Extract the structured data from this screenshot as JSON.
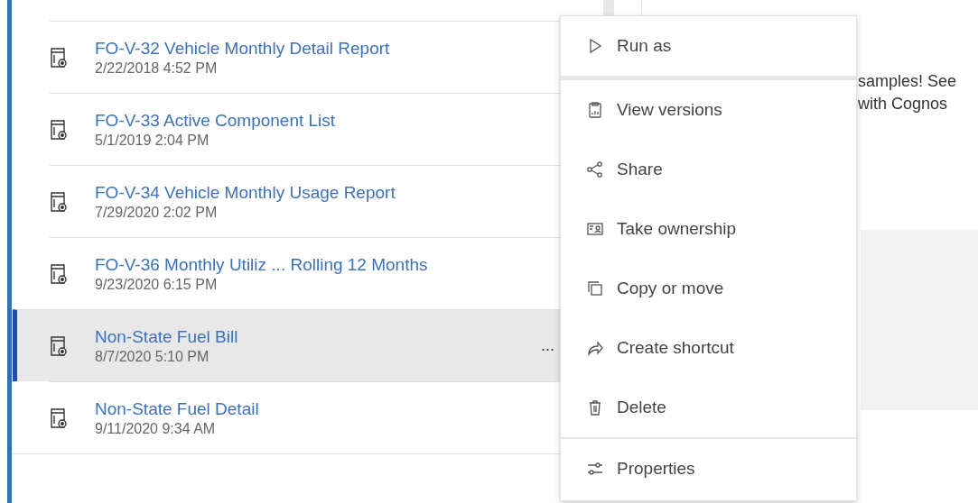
{
  "reports": [
    {
      "title": "FO-V-32 Vehicle Monthly Detail Report",
      "date": "2/22/2018 4:52 PM",
      "selected": false
    },
    {
      "title": "FO-V-33 Active Component List",
      "date": "5/1/2019 2:04 PM",
      "selected": false
    },
    {
      "title": "FO-V-34 Vehicle Monthly Usage Report",
      "date": "7/29/2020 2:02 PM",
      "selected": false
    },
    {
      "title": "FO-V-36 Monthly Utiliz ... Rolling 12 Months",
      "date": "9/23/2020 6:15 PM",
      "selected": false
    },
    {
      "title": "Non-State Fuel Bill",
      "date": "8/7/2020 5:10 PM",
      "selected": true,
      "more": "..."
    },
    {
      "title": "Non-State Fuel Detail",
      "date": "9/11/2020 9:34 AM",
      "selected": false
    }
  ],
  "side_text": [
    "samples! See",
    "with Cognos"
  ],
  "context_menu": [
    [
      "Run as"
    ],
    [
      "View versions",
      "Share",
      "Take ownership",
      "Copy or move",
      "Create shortcut",
      "Delete"
    ],
    [
      "Properties"
    ]
  ]
}
